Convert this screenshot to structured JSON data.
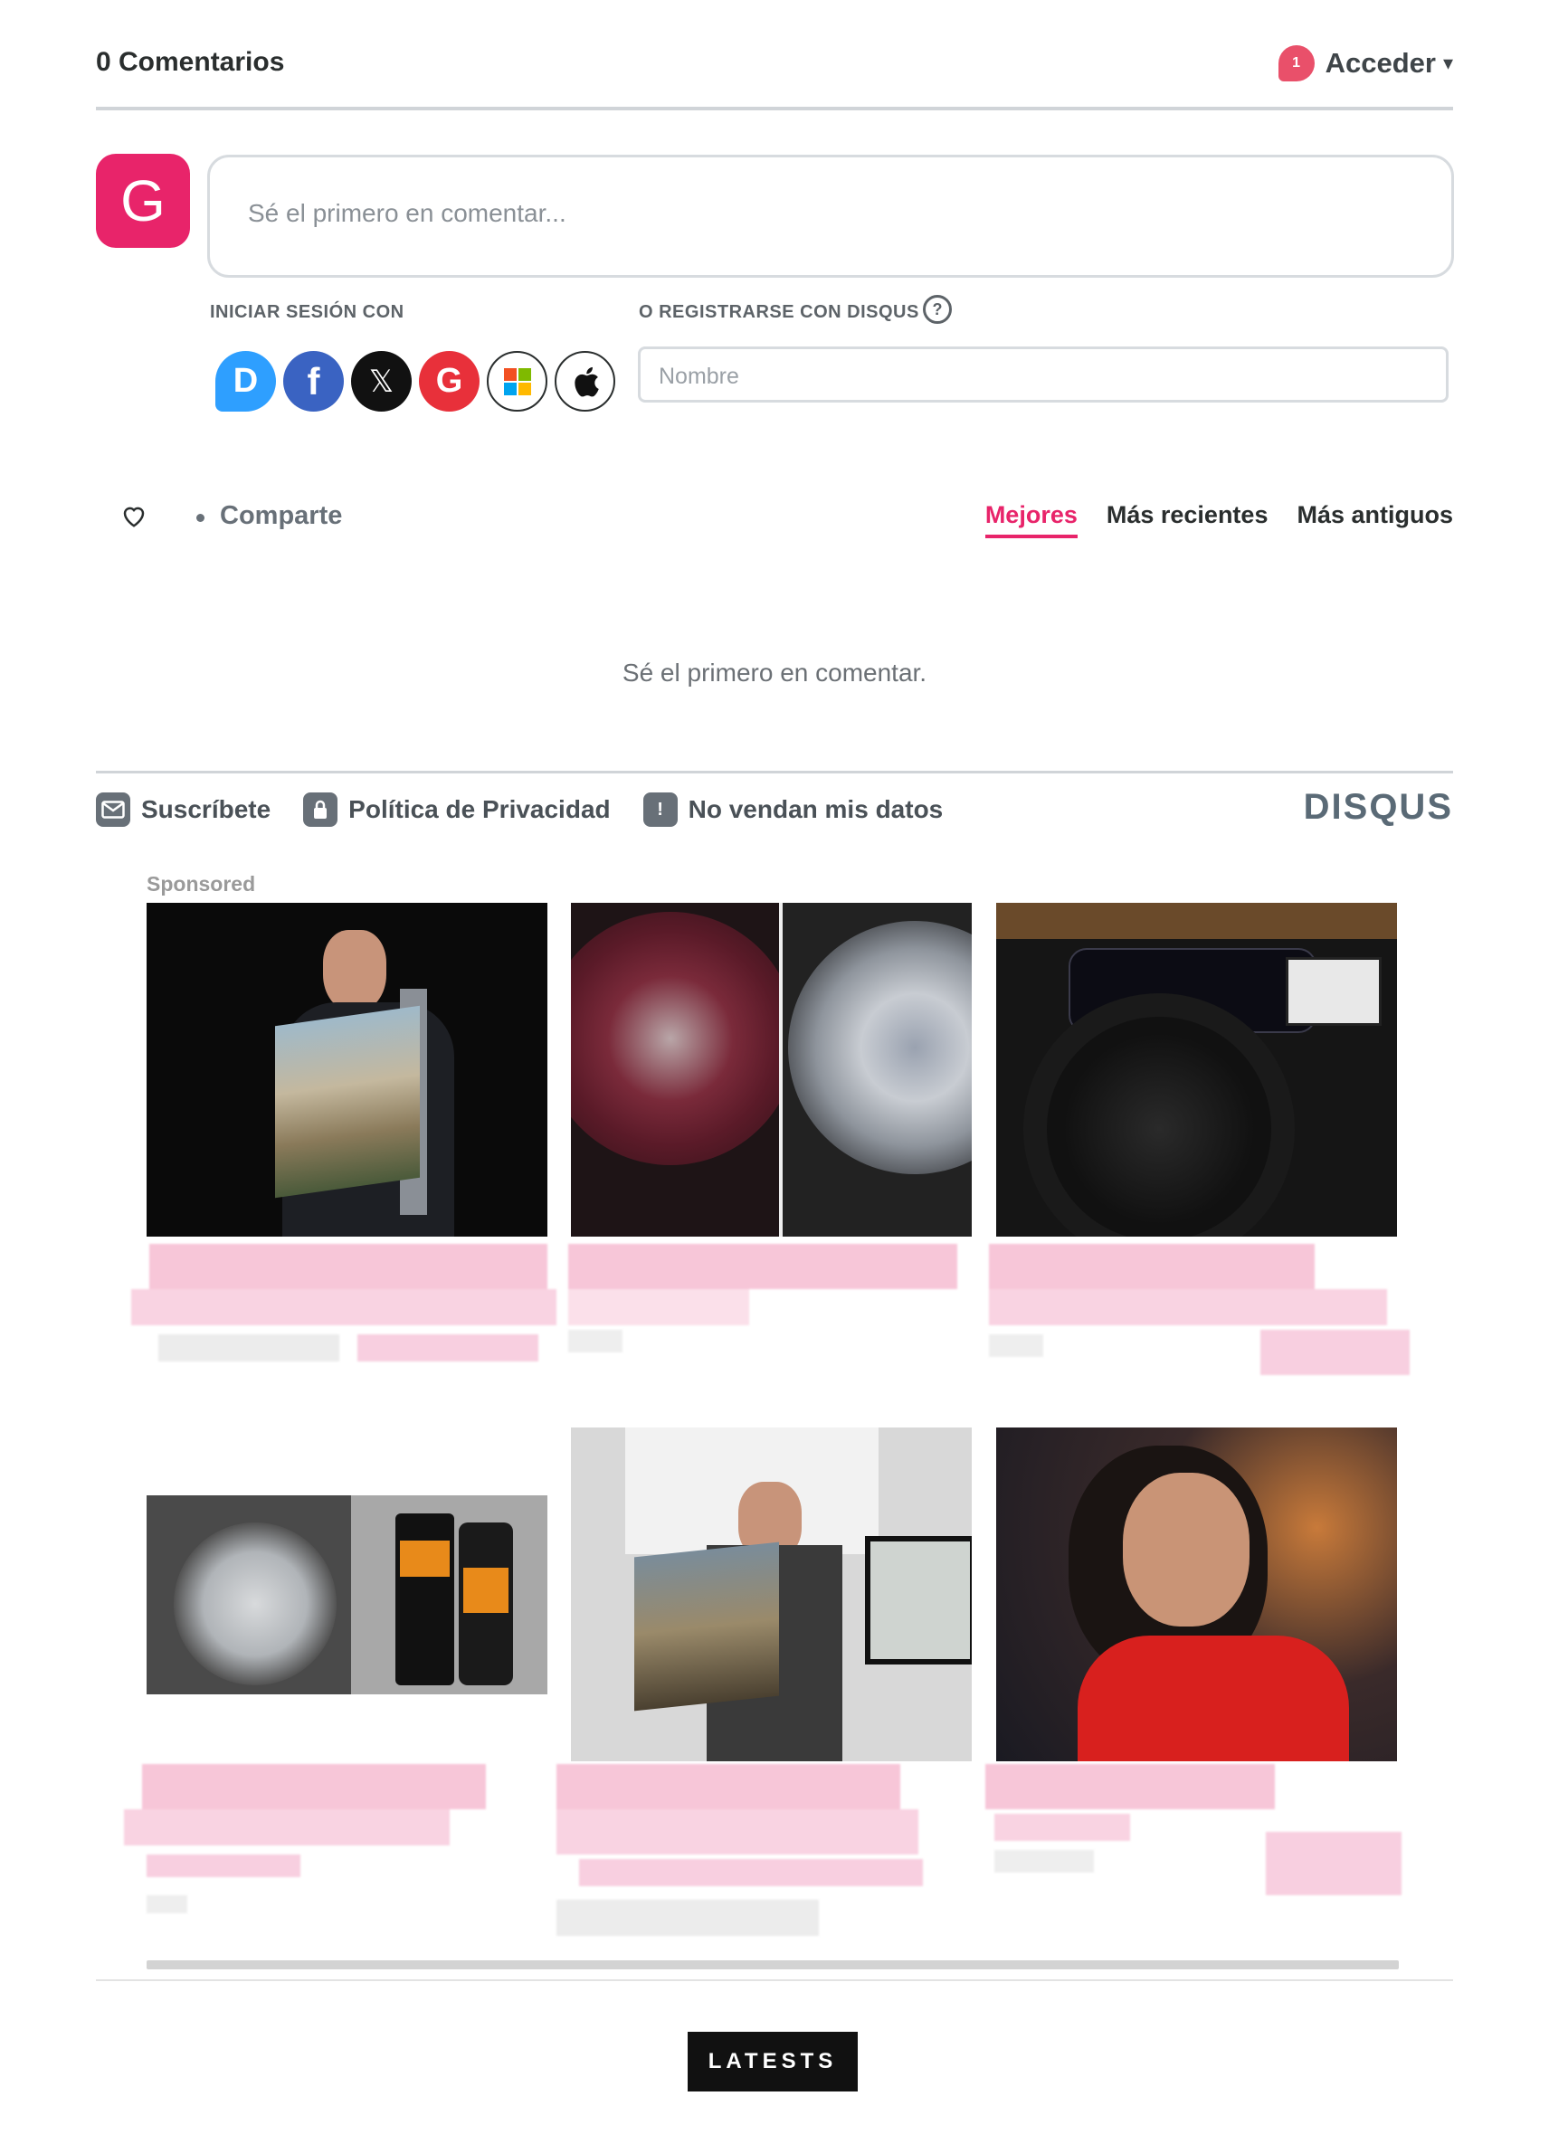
{
  "header": {
    "comment_count": "0 Comentarios",
    "notification_count": "1",
    "login_label": "Acceder",
    "caret": "▾"
  },
  "composer": {
    "avatar_letter": "G",
    "placeholder": "Sé el primero en comentar..."
  },
  "auth": {
    "login_with_label": "INICIAR SESIÓN CON",
    "register_label": "O REGISTRARSE CON DISQUS",
    "help_glyph": "?",
    "providers": [
      {
        "name": "disqus",
        "glyph": "D"
      },
      {
        "name": "facebook",
        "glyph": "f"
      },
      {
        "name": "x",
        "glyph": "𝕏"
      },
      {
        "name": "google",
        "glyph": "G"
      },
      {
        "name": "microsoft",
        "glyph": ""
      },
      {
        "name": "apple",
        "glyph": ""
      }
    ],
    "name_placeholder": "Nombre"
  },
  "toolbar": {
    "share_label": "Comparte",
    "sort_tabs": [
      {
        "label": "Mejores",
        "active": true
      },
      {
        "label": "Más recientes",
        "active": false
      },
      {
        "label": "Más antiguos",
        "active": false
      }
    ]
  },
  "empty_message": "Sé el primero en comentar.",
  "footer": {
    "subscribe": "Suscríbete",
    "privacy": "Política de Privacidad",
    "do_not_sell": "No vendan mis datos",
    "brand": "DISQUS"
  },
  "sponsored": {
    "label": "Sponsored",
    "tiles": [
      {
        "name": "painter-holding-canvas"
      },
      {
        "name": "wheel-cleaner-before-after"
      },
      {
        "name": "car-steering-wheel-kia"
      },
      {
        "name": "wheel-cleaner-spray-product"
      },
      {
        "name": "painter-studio-canvas"
      },
      {
        "name": "smiling-woman-red-sweater"
      }
    ]
  },
  "latests_button": "LATESTS",
  "colors": {
    "accent": "#e8246a",
    "badge": "#e9506a",
    "text": "#2a2e2e",
    "muted": "#687078"
  }
}
